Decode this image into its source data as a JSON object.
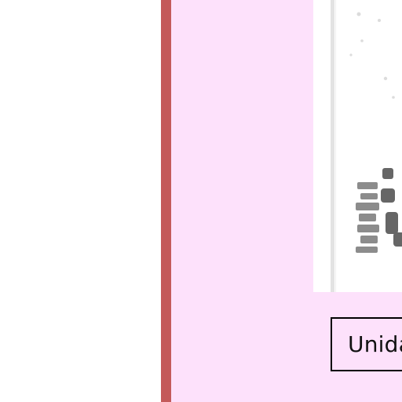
{
  "colors": {
    "page_background": "#ffffff",
    "accent_bar": "#c45a5a",
    "panel_background": "#fde1fb",
    "label_border": "#000000"
  },
  "preview": {
    "icon": "document-thumbnail-icon"
  },
  "unit_label": {
    "text": "Unida"
  }
}
